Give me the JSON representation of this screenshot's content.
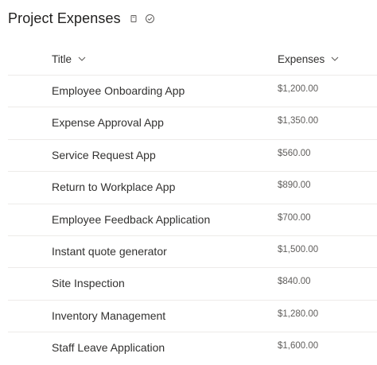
{
  "page": {
    "title": "Project Expenses"
  },
  "header_icons": [
    "note-icon",
    "checkmark-circle-icon"
  ],
  "columns": {
    "title": "Title",
    "expenses": "Expenses"
  },
  "rows": [
    {
      "title": "Employee Onboarding App",
      "expenses": "$1,200.00"
    },
    {
      "title": "Expense Approval App",
      "expenses": "$1,350.00"
    },
    {
      "title": "Service Request App",
      "expenses": "$560.00"
    },
    {
      "title": "Return to Workplace App",
      "expenses": "$890.00"
    },
    {
      "title": "Employee Feedback Application",
      "expenses": "$700.00"
    },
    {
      "title": "Instant quote generator",
      "expenses": "$1,500.00"
    },
    {
      "title": "Site Inspection",
      "expenses": "$840.00"
    },
    {
      "title": "Inventory Management",
      "expenses": "$1,280.00"
    },
    {
      "title": "Staff Leave Application",
      "expenses": "$1,600.00"
    }
  ]
}
